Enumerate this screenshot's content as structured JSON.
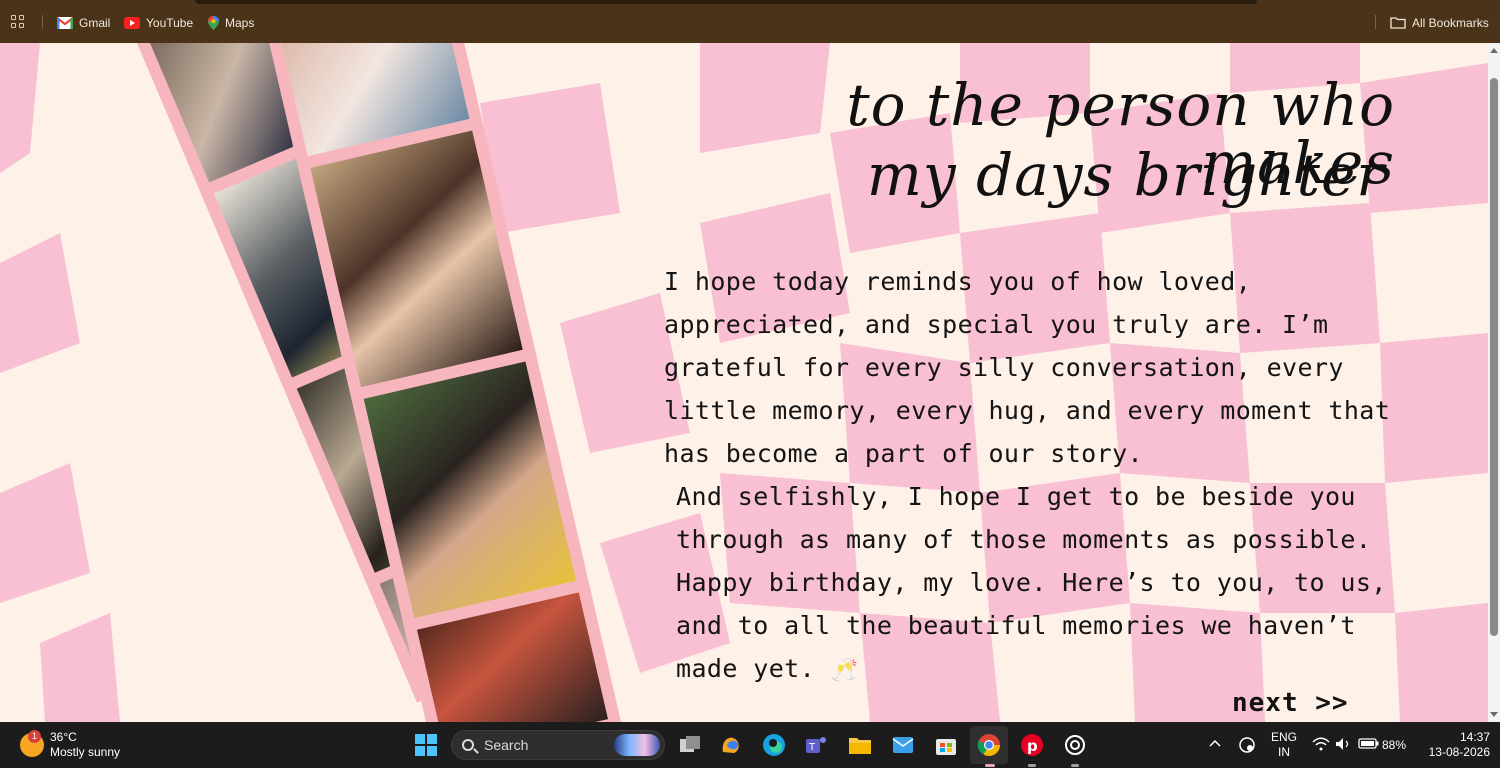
{
  "bookmarks": {
    "items": [
      {
        "label": "Gmail",
        "icon": "gmail-icon"
      },
      {
        "label": "YouTube",
        "icon": "youtube-icon"
      },
      {
        "label": "Maps",
        "icon": "maps-icon"
      }
    ],
    "all_bookmarks": "All Bookmarks"
  },
  "page": {
    "title_line1": "to the person who makes",
    "title_line2": "my days brighter",
    "message_p1": "I hope today reminds you of how loved, appreciated, and special you truly are. I’m grateful for every silly conversation, every little memory, every hug, and every moment that has become a part of our story.",
    "message_p2": "And selfishly, I hope I get to be beside you through as many of those moments as possible. Happy birthday, my love. Here’s to you, to us, and to all the beautiful memories we haven’t made yet.",
    "message_emoji": "🥂",
    "next_label": "next >>",
    "colors": {
      "pink": "#f9bfd3",
      "cream": "#fdf1e8",
      "strip": "#f7b6be",
      "text": "#141414"
    }
  },
  "taskbar": {
    "weather_temp": "36°C",
    "weather_desc": "Mostly sunny",
    "weather_badge": "1",
    "search_label": "Search",
    "apps": [
      "task-view-icon",
      "copilot-icon",
      "edge-icon",
      "teams-icon",
      "file-explorer-icon",
      "mail-icon",
      "store-icon",
      "chrome-icon",
      "pinterest-icon",
      "chatgpt-icon"
    ],
    "lang_top": "ENG",
    "lang_bottom": "IN",
    "battery": "88%",
    "time": "14:37",
    "date": "13-08-2026"
  }
}
